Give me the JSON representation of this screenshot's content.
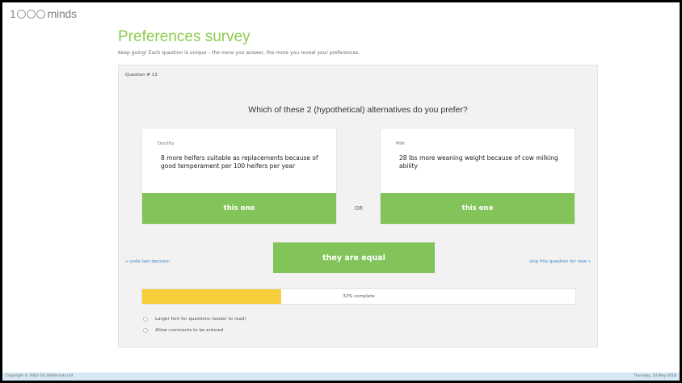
{
  "app": {
    "logo_number": "1",
    "logo_name": "minds",
    "logo_mark": "1000minds"
  },
  "page": {
    "title": "Preferences survey",
    "subtitle": "Keep going! Each question is unique – the more you answer, the more you reveal your preferences."
  },
  "survey": {
    "question_number": "Question # 13",
    "question": "Which of these 2 (hypothetical) alternatives do you prefer?",
    "left": {
      "criterion": "Docility",
      "description": "8 more heifers suitable as replacements because of good temperament per 100 heifers per year",
      "button": "this one"
    },
    "right": {
      "criterion": "Milk",
      "description": "28 lbs more weaning weight because of cow milking ability",
      "button": "this one"
    },
    "or_label": "OR",
    "equal_button": "they are equal",
    "undo_link": "« undo last decision",
    "skip_link": "skip this question for now »",
    "progress": {
      "percent": 32,
      "label": "32% complete"
    },
    "options": [
      {
        "label": "Larger font for questions (easier to read)",
        "checked": false
      },
      {
        "label": "Allow comments to be entered",
        "checked": false
      }
    ]
  },
  "footer": {
    "copyright": "Copyright © 2002-18 1000minds Ltd",
    "date": "Thursday, 24 May 2018"
  },
  "colors": {
    "accent_green": "#82c45a",
    "title_green": "#8ccc4f",
    "progress_yellow": "#f8cf3a",
    "link_blue": "#3a86c8"
  }
}
